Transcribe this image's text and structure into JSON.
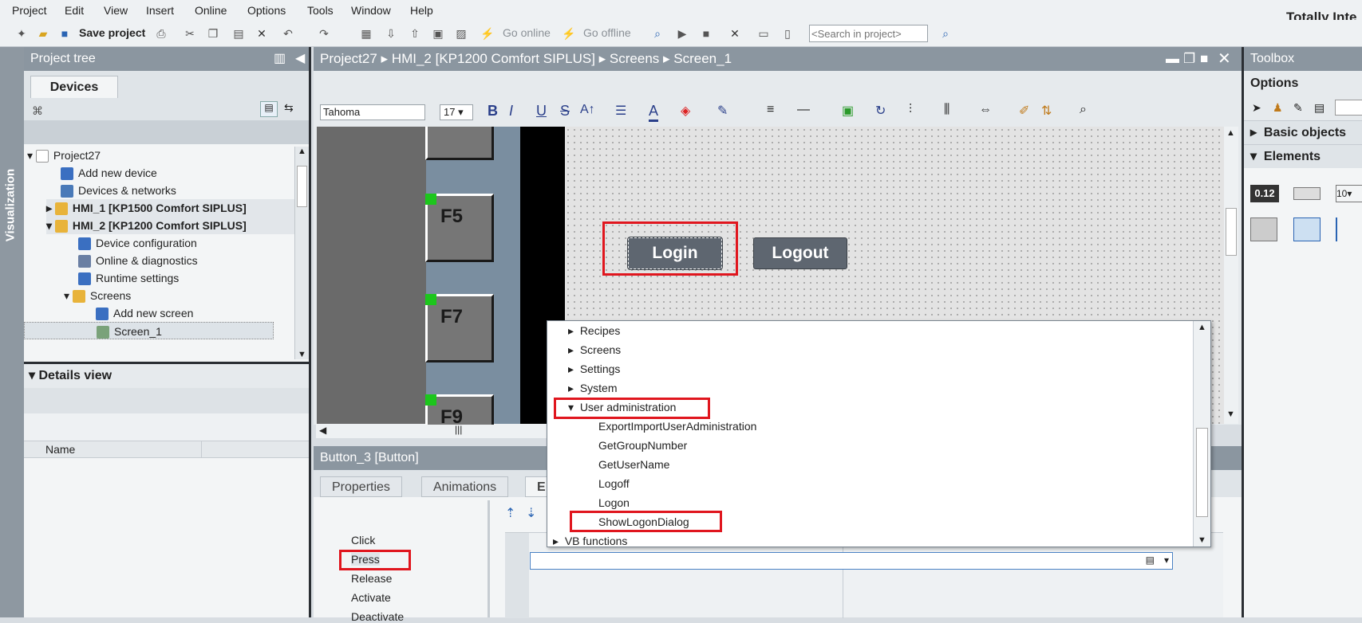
{
  "menu": [
    "Project",
    "Edit",
    "View",
    "Insert",
    "Online",
    "Options",
    "Tools",
    "Window",
    "Help"
  ],
  "brand": "Totally Inte",
  "toolbar": {
    "save_label": "Save project",
    "go_online": "Go online",
    "go_offline": "Go offline",
    "search_placeholder": "<Search in project>"
  },
  "left_tab": "Visualization",
  "project_tree": {
    "title": "Project tree",
    "tab": "Devices",
    "items": [
      {
        "label": "Project27"
      },
      {
        "label": "Add new device"
      },
      {
        "label": "Devices & networks"
      },
      {
        "label": "HMI_1 [KP1500 Comfort SIPLUS]"
      },
      {
        "label": "HMI_2 [KP1200 Comfort SIPLUS]"
      },
      {
        "label": "Device configuration"
      },
      {
        "label": "Online & diagnostics"
      },
      {
        "label": "Runtime settings"
      },
      {
        "label": "Screens"
      },
      {
        "label": "Add new screen"
      },
      {
        "label": "Screen_1"
      }
    ]
  },
  "details_view": {
    "title": "Details view",
    "col_name": "Name"
  },
  "breadcrumb": [
    "Project27",
    "HMI_2 [KP1200 Comfort SIPLUS]",
    "Screens",
    "Screen_1"
  ],
  "format": {
    "font": "Tahoma",
    "size": "17"
  },
  "hmi": {
    "keys": [
      "F5",
      "F7",
      "F9"
    ],
    "login": "Login",
    "logout": "Logout"
  },
  "inspector": {
    "title": "Button_3 [Button]",
    "tabs": [
      "Properties",
      "Animations",
      "E"
    ],
    "events": [
      "Click",
      "Press",
      "Release",
      "Activate",
      "Deactivate"
    ]
  },
  "dropdown": {
    "items": [
      "Recipes",
      "Screens",
      "Settings",
      "System",
      "User administration",
      "ExportImportUserAdministration",
      "GetGroupNumber",
      "GetUserName",
      "Logoff",
      "Logon",
      "ShowLogonDialog",
      "VB functions"
    ]
  },
  "toolbox": {
    "title": "Toolbox",
    "options": "Options",
    "basic": "Basic objects",
    "elements": "Elements",
    "io_label": "0.12"
  }
}
